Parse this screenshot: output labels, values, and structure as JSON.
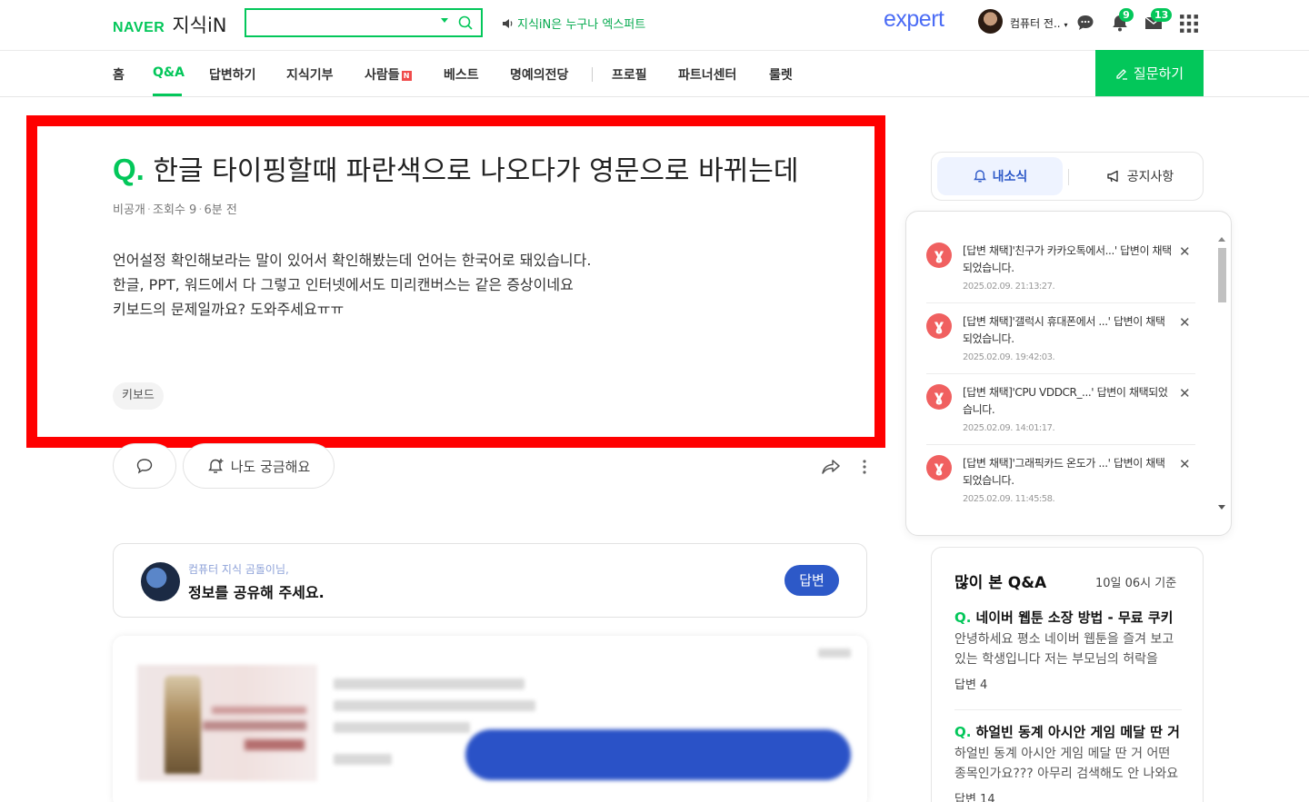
{
  "header": {
    "naver_logo": "NAVER",
    "service_logo": "지식iN",
    "search_placeholder": "",
    "notice": "지식iN은 누구나 엑스퍼트",
    "expert_logo": "expert",
    "username": "컴퓨터 전..",
    "notifications_badge": "9",
    "messages_badge": "13"
  },
  "nav": {
    "items": [
      "홈",
      "Q&A",
      "답변하기",
      "지식기부",
      "사람들",
      "베스트",
      "명예의전당",
      "프로필",
      "파트너센터",
      "룰렛"
    ],
    "active": "Q&A",
    "new_badge": "N",
    "ask_button": "질문하기"
  },
  "question": {
    "q_mark": "Q.",
    "title": "한글 타이핑할때 파란색으로 나오다가 영문으로 바뀌는데",
    "visibility": "비공개",
    "views": "조회수 9",
    "time": "6분 전",
    "body": [
      "언어설정 확인해보라는 말이 있어서 확인해봤는데 언어는 한국어로 돼있습니다.",
      "한글, PPT, 워드에서 다 그렇고 인터넷에서도 미리캔버스는 같은 증상이네요",
      "키보드의 문제일까요? 도와주세요ㅠㅠ"
    ],
    "tag": "키보드",
    "curious_button": "나도 궁금해요"
  },
  "share_prompt": {
    "subtitle": "컴퓨터 지식 곰돌이님,",
    "message": "정보를 공유해 주세요.",
    "answer_button": "답변"
  },
  "side_tabs": {
    "my_news": "내소식",
    "notice": "공지사항"
  },
  "notifications": [
    {
      "text": "[답변 채택]'친구가 카카오톡에서...' 답변이 채택되었습니다.",
      "time": "2025.02.09. 21:13:27."
    },
    {
      "text": "[답변 채택]'갤럭시 휴대폰에서 ...' 답변이 채택되었습니다.",
      "time": "2025.02.09. 19:42:03."
    },
    {
      "text": "[답변 채택]'CPU VDDCR_...' 답변이 채택되었습니다.",
      "time": "2025.02.09. 14:01:17."
    },
    {
      "text": "[답변 채택]'그래픽카드 온도가 ...' 답변이 채택되었습니다.",
      "time": "2025.02.09. 11:45:58."
    }
  ],
  "popular": {
    "title": "많이 본 Q&A",
    "basis": "10일 06시 기준",
    "items": [
      {
        "q": "네이버 웹툰 소장 방법 - 무료 쿠키",
        "body": "안녕하세요 평소 네이버 웹툰을 즐겨 보고 있는 학생입니다 저는 부모님의 허락을",
        "answers": "답변 4"
      },
      {
        "q": "하얼빈 동계 아시안 게임 메달 딴 거",
        "body": "하얼빈 동계 아시안 게임 메달 딴 거 어떤 종목인가요??? 아무리 검색해도 안 나와요",
        "answers": "답변 14"
      }
    ]
  },
  "colors": {
    "brand_green": "#03c75a",
    "accent_blue": "#2d59c8",
    "highlight_red": "#ff0000"
  }
}
